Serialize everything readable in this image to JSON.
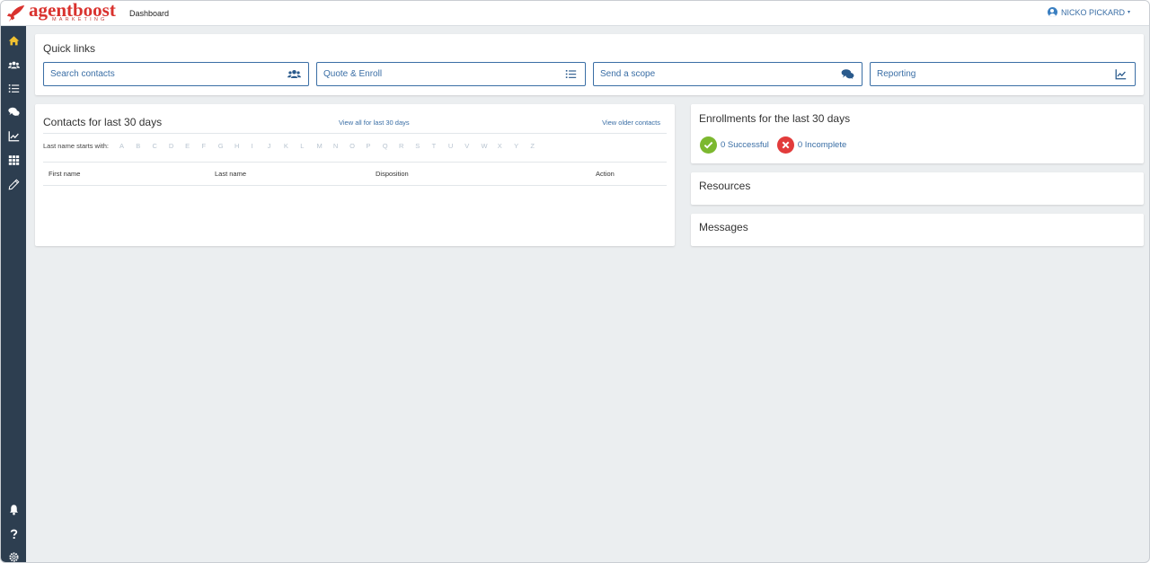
{
  "brand": {
    "wordmark": "agentboost",
    "tagline": "MARKETING",
    "color": "#d9322e"
  },
  "header": {
    "page_title": "Dashboard",
    "user_name": "NICKO PICKARD",
    "user_caret": "▾"
  },
  "sidebar": {
    "items": [
      {
        "icon": "home-icon",
        "active": true
      },
      {
        "icon": "users-icon"
      },
      {
        "icon": "list-icon"
      },
      {
        "icon": "comments-icon"
      },
      {
        "icon": "chart-line-icon"
      },
      {
        "icon": "grid-icon"
      },
      {
        "icon": "pencil-icon"
      }
    ],
    "bottom_items": [
      {
        "icon": "bell-icon"
      },
      {
        "icon": "help-icon"
      },
      {
        "icon": "settings-icon"
      }
    ]
  },
  "quick_links": {
    "title": "Quick links",
    "buttons": [
      {
        "label": "Search contacts",
        "icon": "users-icon"
      },
      {
        "label": "Quote & Enroll",
        "icon": "list-icon"
      },
      {
        "label": "Send a scope",
        "icon": "comments-icon"
      },
      {
        "label": "Reporting",
        "icon": "chart-line-icon"
      }
    ]
  },
  "contacts": {
    "title": "Contacts for last 30 days",
    "view_all": "View all for last 30 days",
    "view_older": "View older contacts",
    "alpha_label": "Last name starts with:",
    "letters": [
      "A",
      "B",
      "C",
      "D",
      "E",
      "F",
      "G",
      "H",
      "I",
      "J",
      "K",
      "L",
      "M",
      "N",
      "O",
      "P",
      "Q",
      "R",
      "S",
      "T",
      "U",
      "V",
      "W",
      "X",
      "Y",
      "Z"
    ],
    "columns": [
      "First name",
      "Last name",
      "Disposition",
      "Action"
    ]
  },
  "enrollments": {
    "title": "Enrollments for the last 30 days",
    "successful": "0 Successful",
    "incomplete": "0 Incomplete",
    "success_color": "#7cb82f",
    "incomplete_color": "#e23b3b"
  },
  "resources": {
    "title": "Resources"
  },
  "messages": {
    "title": "Messages"
  },
  "colors": {
    "sidebar_bg": "#2d3e50",
    "sidebar_icon": "#ffffff",
    "active_icon": "#f2c230",
    "accent": "#3a6ea5",
    "page_bg": "#ebeef0"
  }
}
